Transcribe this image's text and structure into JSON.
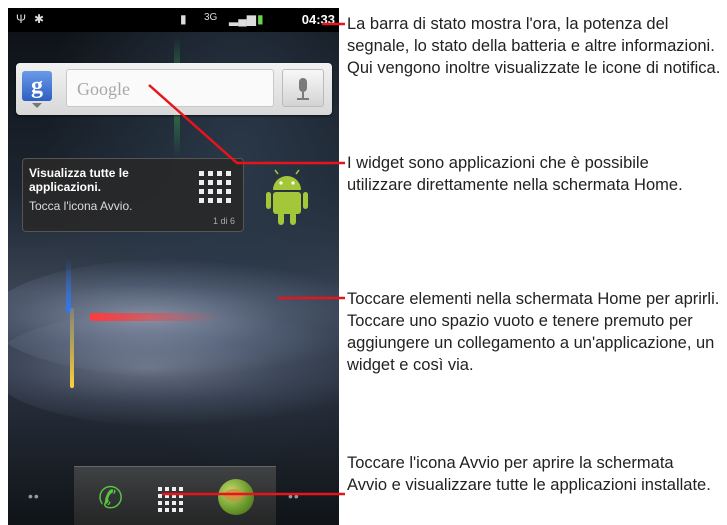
{
  "status_bar": {
    "time": "04:33",
    "icons": [
      "usb-icon",
      "bug-icon",
      "sd-card-icon",
      "network-3g-icon",
      "signal-icon",
      "battery-icon"
    ]
  },
  "search_widget": {
    "logo_letter": "g",
    "placeholder": "Google",
    "icons": [
      "google-logo-icon",
      "microphone-icon"
    ]
  },
  "hint_card": {
    "title": "Visualizza tutte le applicazioni.",
    "body": "Tocca l'icona Avvio.",
    "page": "1 di 6"
  },
  "dock": {
    "icons": [
      "phone-icon",
      "launcher-grid-icon",
      "browser-icon"
    ],
    "dots_left": "••",
    "dots_right": "••"
  },
  "callouts": [
    "La barra di stato mostra l'ora, la potenza del segnale, lo stato della batteria e altre informazioni. Qui vengono inoltre visualizzate le icone di notifica.",
    "I widget sono applicazioni che è possibile utilizzare direttamente nella schermata Home.",
    "Toccare elementi nella schermata Home per aprirli. Toccare uno spazio vuoto e tenere premuto per aggiungere un collegamento a un'applicazione, un widget e così via.",
    "Toccare l'icona Avvio per aprire la schermata Avvio e visualizzare tutte le applicazioni installate."
  ],
  "colors": {
    "callout_line": "#e8141c",
    "statusbar_bg": "#000000",
    "phone_green": "#59c342",
    "android_green": "#a4c639"
  }
}
